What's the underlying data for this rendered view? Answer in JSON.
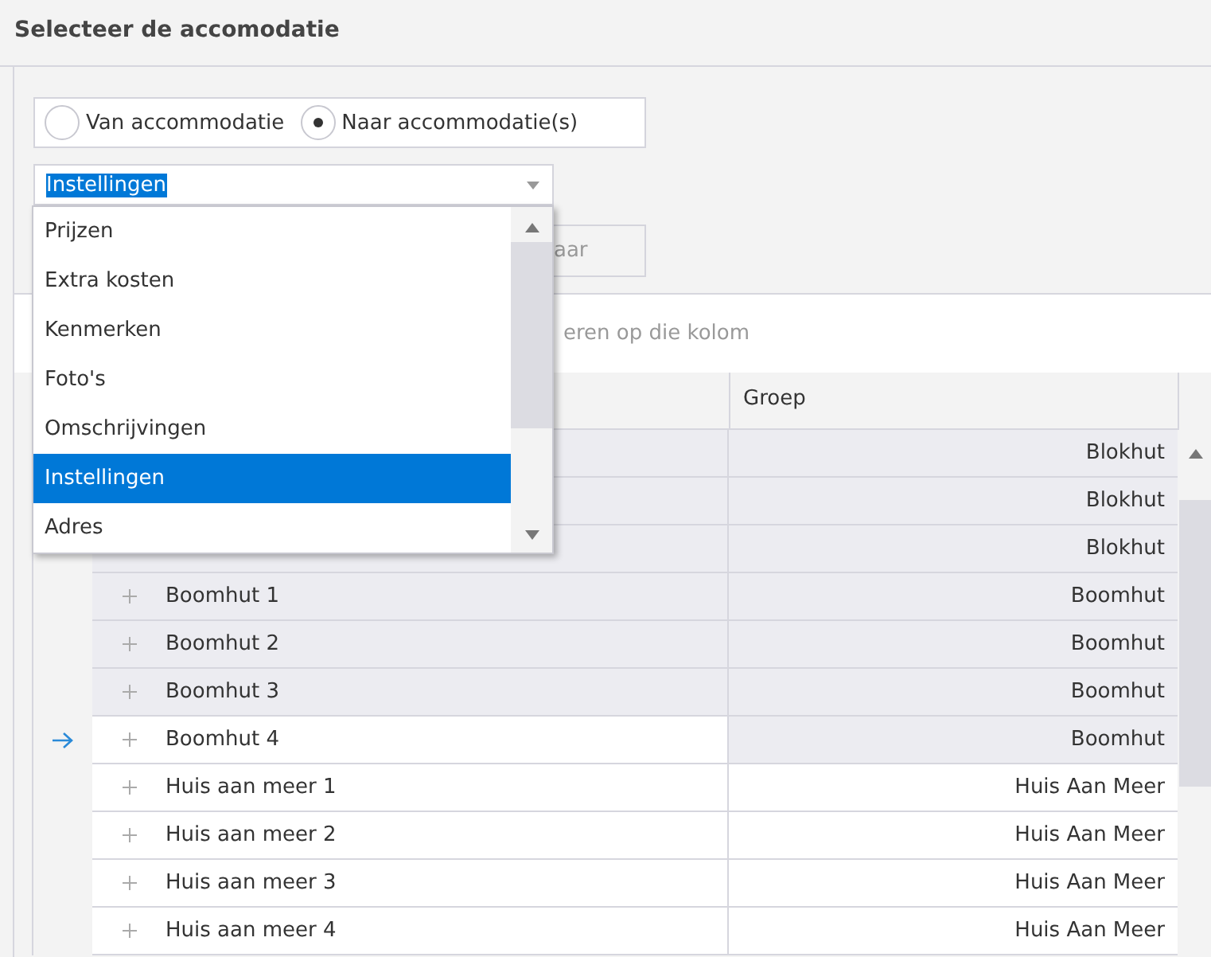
{
  "title": "Selecteer de accomodatie",
  "radios": [
    {
      "label": "Van accommodatie",
      "selected": false
    },
    {
      "label": "Naar accommodatie(s)",
      "selected": true
    }
  ],
  "combo": {
    "value": "Instellingen",
    "expanded": true
  },
  "dropdown": [
    {
      "label": "Prijzen",
      "selected": false
    },
    {
      "label": "Extra kosten",
      "selected": false
    },
    {
      "label": "Kenmerken",
      "selected": false
    },
    {
      "label": "Foto's",
      "selected": false
    },
    {
      "label": "Omschrijvingen",
      "selected": false
    },
    {
      "label": "Instellingen",
      "selected": true
    },
    {
      "label": "Adres",
      "selected": false
    }
  ],
  "button": "aar",
  "group_panel": "eren op die kolom",
  "table": {
    "columns": [
      "Groep"
    ],
    "rows": [
      {
        "group": "Blokhut",
        "selected": true,
        "focused": false
      },
      {
        "group": "Blokhut",
        "selected": true,
        "focused": false
      },
      {
        "group": "Blokhut",
        "selected": true,
        "focused": false
      },
      {
        "name": "Boomhut 1",
        "group": "Boomhut",
        "selected": true,
        "focused": false
      },
      {
        "name": "Boomhut 2",
        "group": "Boomhut",
        "selected": true,
        "focused": false
      },
      {
        "name": "Boomhut 3",
        "group": "Boomhut",
        "selected": true,
        "focused": false
      },
      {
        "name": "Boomhut 4",
        "group": "Boomhut",
        "selected": true,
        "focused": true
      },
      {
        "name": "Huis aan meer 1",
        "group": "Huis Aan Meer",
        "selected": false,
        "focused": false
      },
      {
        "name": "Huis aan meer 2",
        "group": "Huis Aan Meer",
        "selected": false,
        "focused": false
      },
      {
        "name": "Huis aan meer 3",
        "group": "Huis Aan Meer",
        "selected": false,
        "focused": false
      },
      {
        "name": "Huis aan meer 4",
        "group": "Huis Aan Meer",
        "selected": false,
        "focused": false
      }
    ]
  }
}
